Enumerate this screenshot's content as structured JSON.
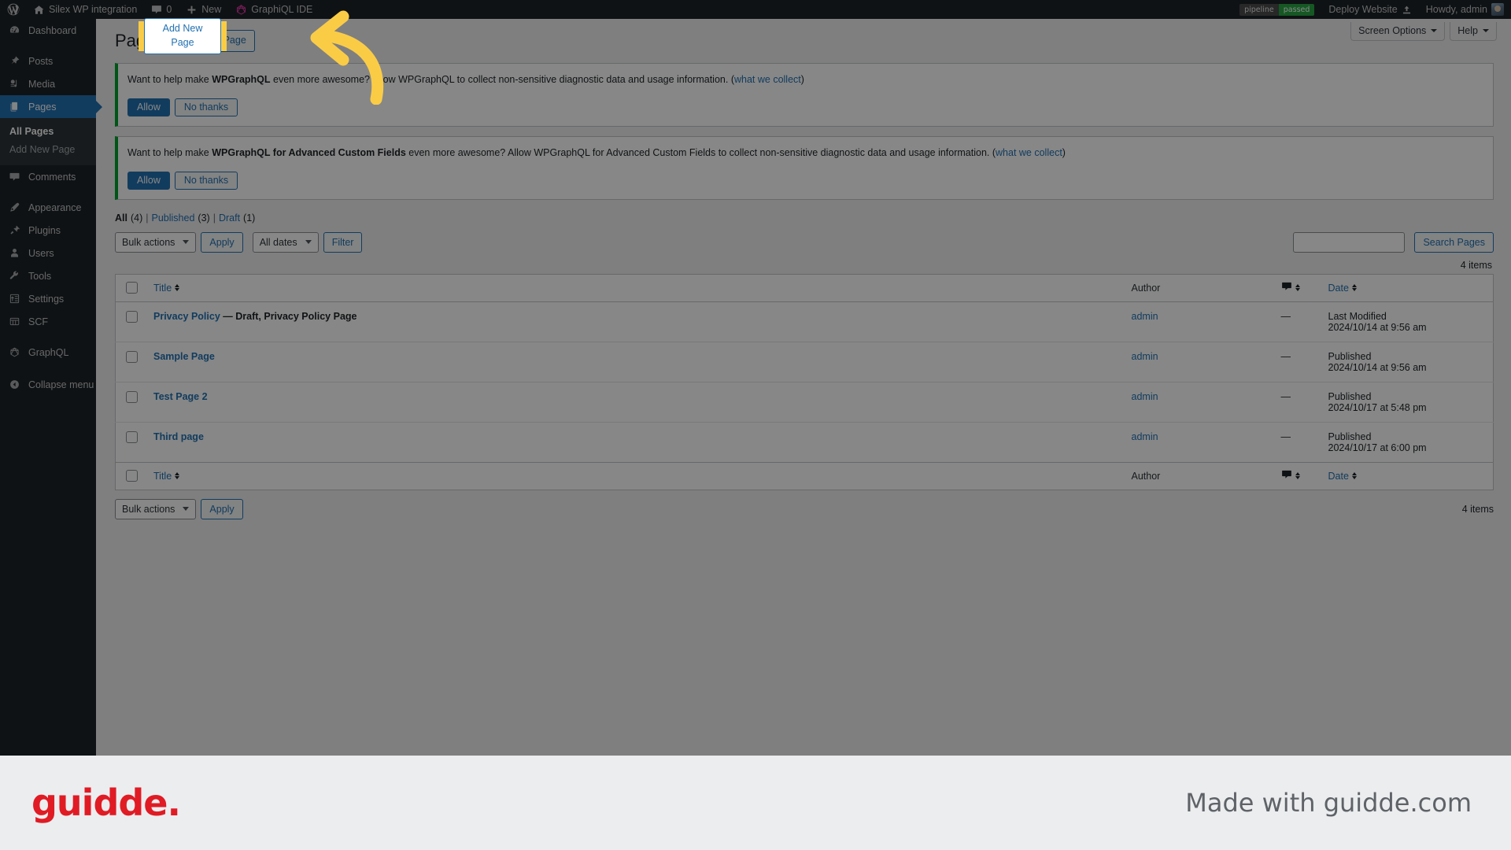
{
  "adminbar": {
    "wp_logo": "wordpress-logo-icon",
    "site_name": "Silex WP integration",
    "comments_count": "0",
    "new_label": "New",
    "graphql_label": "GraphiQL IDE",
    "pipeline_label": "pipeline",
    "pipeline_status": "passed",
    "deploy_label": "Deploy Website",
    "howdy": "Howdy, admin"
  },
  "sidebar": {
    "items": [
      {
        "label": "Dashboard",
        "icon": "dashboard-icon",
        "current": false
      },
      {
        "label": "Posts",
        "icon": "posts-pin-icon",
        "current": false
      },
      {
        "label": "Media",
        "icon": "media-icon",
        "current": false
      },
      {
        "label": "Pages",
        "icon": "pages-icon",
        "current": true
      },
      {
        "label": "Comments",
        "icon": "comments-icon",
        "current": false
      },
      {
        "label": "Appearance",
        "icon": "appearance-brush-icon",
        "current": false
      },
      {
        "label": "Plugins",
        "icon": "plugins-plug-icon",
        "current": false
      },
      {
        "label": "Users",
        "icon": "users-icon",
        "current": false
      },
      {
        "label": "Tools",
        "icon": "tools-wrench-icon",
        "current": false
      },
      {
        "label": "Settings",
        "icon": "settings-sliders-icon",
        "current": false
      },
      {
        "label": "SCF",
        "icon": "scf-grid-icon",
        "current": false
      },
      {
        "label": "GraphQL",
        "icon": "graphql-icon",
        "current": false
      }
    ],
    "submenu": [
      {
        "label": "All Pages",
        "current": true
      },
      {
        "label": "Add New Page",
        "current": false
      }
    ],
    "collapse_label": "Collapse menu"
  },
  "screen_meta": {
    "screen_options": "Screen Options",
    "help": "Help"
  },
  "page": {
    "title": "Pages",
    "add_new_label": "Add New Page"
  },
  "notices": [
    {
      "text_before": "Want to help make ",
      "bold": "WPGraphQL",
      "text_after": " even more awesome? Allow WPGraphQL to collect non-sensitive diagnostic data and usage information. (",
      "link": "what we collect",
      "text_end": ")",
      "allow_label": "Allow",
      "decline_label": "No thanks"
    },
    {
      "text_before": "Want to help make ",
      "bold": "WPGraphQL for Advanced Custom Fields",
      "text_after": " even more awesome? Allow WPGraphQL for Advanced Custom Fields to collect non-sensitive diagnostic data and usage information. (",
      "link": "what we collect",
      "text_end": ")",
      "allow_label": "Allow",
      "decline_label": "No thanks"
    }
  ],
  "status_links": {
    "all_label": "All",
    "all_count": "(4)",
    "published_label": "Published",
    "published_count": "(3)",
    "draft_label": "Draft",
    "draft_count": "(1)",
    "separator": "|"
  },
  "tablenav": {
    "bulk_actions": "Bulk actions",
    "apply_label": "Apply",
    "all_dates": "All dates",
    "filter_label": "Filter",
    "search_value": "",
    "search_placeholder": "",
    "search_button": "Search Pages",
    "items_count": "4 items",
    "items_count_bottom": "4 items"
  },
  "table": {
    "columns": {
      "title": "Title",
      "author": "Author",
      "comments": "comment-bubble-icon",
      "date": "Date"
    },
    "rows": [
      {
        "title": "Privacy Policy",
        "state": "— Draft, Privacy Policy Page",
        "author": "admin",
        "comments": "—",
        "date_status": "Last Modified",
        "date_value": "2024/10/14 at 9:56 am"
      },
      {
        "title": "Sample Page",
        "state": "",
        "author": "admin",
        "comments": "—",
        "date_status": "Published",
        "date_value": "2024/10/14 at 9:56 am"
      },
      {
        "title": "Test Page 2",
        "state": "",
        "author": "admin",
        "comments": "—",
        "date_status": "Published",
        "date_value": "2024/10/17 at 5:48 pm"
      },
      {
        "title": "Third page",
        "state": "",
        "author": "admin",
        "comments": "—",
        "date_status": "Published",
        "date_value": "2024/10/17 at 6:00 pm"
      }
    ]
  },
  "highlight": {
    "target_label": "Add New Page",
    "highlight_color": "#FACC46",
    "arrow": "curved-arrow-left"
  },
  "footer": {
    "logo_text": "guidde.",
    "made_with": "Made with guidde.com",
    "logo_color": "#e01b24"
  }
}
